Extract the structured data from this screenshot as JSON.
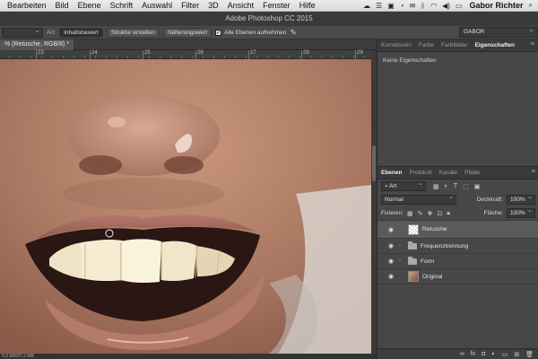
{
  "menubar": {
    "items": [
      "Bearbeiten",
      "Bild",
      "Ebene",
      "Schrift",
      "Auswahl",
      "Filter",
      "3D",
      "Ansicht",
      "Fenster",
      "Hilfe"
    ],
    "user": "Gabor Richter"
  },
  "app": {
    "title": "Adobe Photoshop CC 2015"
  },
  "options": {
    "art_label": "Art:",
    "inhaltsbasiert": "Inhaltsbasiert",
    "struktur": "Struktur erstellen",
    "naeherung": "Näherungswert",
    "alle_ebenen": "Alle Ebenen aufnehmen",
    "workspace": "GABOR"
  },
  "document": {
    "tab_title": "% (Retusche, RGB/8) *"
  },
  "ruler": {
    "ticks": [
      "23",
      "24",
      "25",
      "26",
      "27",
      "28",
      "29"
    ]
  },
  "status": {
    "text": "5,9 MB/97,3 MB"
  },
  "props_panel": {
    "tabs": [
      "Korrekturen",
      "Farbe",
      "Farbfelder",
      "Eigenschaften"
    ],
    "active_tab": "Eigenschaften",
    "body_text": "Keine Eigenschaften"
  },
  "layers_panel": {
    "tabs": [
      "Ebenen",
      "Protokoll",
      "Kanäle",
      "Pfade"
    ],
    "active_tab": "Ebenen",
    "filter_kind": "Art",
    "blend_mode": "Normal",
    "opacity_label": "Deckkraft:",
    "opacity_value": "100%",
    "lock_label": "Fixieren:",
    "fill_label": "Fläche:",
    "fill_value": "100%",
    "layers": [
      {
        "name": "Retusche",
        "type": "pixel",
        "selected": true
      },
      {
        "name": "Frequenztrennung",
        "type": "group",
        "selected": false
      },
      {
        "name": "Form",
        "type": "group",
        "selected": false
      },
      {
        "name": "Original",
        "type": "pixel",
        "selected": false
      }
    ]
  },
  "colors": {
    "accent": "#5a5a5a",
    "panel_bg": "#474747",
    "canvas_bg": "#2b2b2b"
  }
}
